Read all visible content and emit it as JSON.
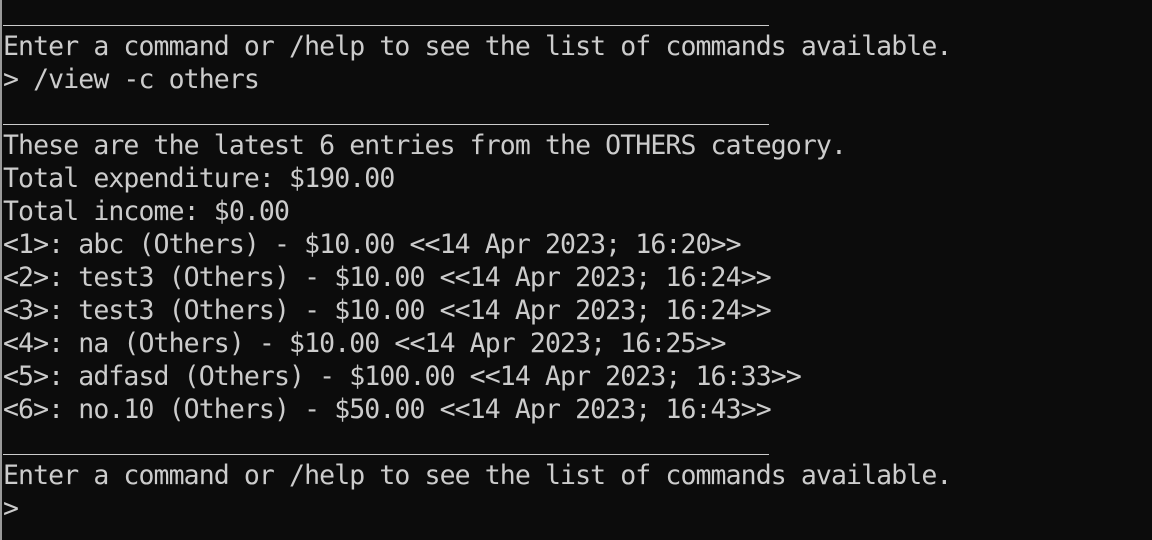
{
  "terminal": {
    "prompt_message_1": "Enter a command or /help to see the list of commands available.",
    "command_line": "> /view -c others",
    "header": "These are the latest 6 entries from the OTHERS category.",
    "total_expenditure": "Total expenditure: $190.00",
    "total_income": "Total income: $0.00",
    "entries": [
      "<1>: abc (Others) - $10.00 <<14 Apr 2023; 16:20>>",
      "<2>: test3 (Others) - $10.00 <<14 Apr 2023; 16:24>>",
      "<3>: test3 (Others) - $10.00 <<14 Apr 2023; 16:24>>",
      "<4>: na (Others) - $10.00 <<14 Apr 2023; 16:25>>",
      "<5>: adfasd (Others) - $100.00 <<14 Apr 2023; 16:33>>",
      "<6>: no.10 (Others) - $50.00 <<14 Apr 2023; 16:43>>"
    ],
    "prompt_message_2": "Enter a command or /help to see the list of commands available.",
    "current_prompt": ">",
    "colors": {
      "background": "#0c0c0c",
      "text": "#cccccc"
    }
  }
}
